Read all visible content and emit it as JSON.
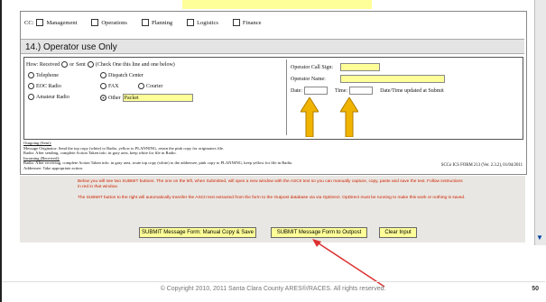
{
  "cc": {
    "label": "CC:",
    "options": [
      "Management",
      "Operations",
      "Planning",
      "Logistics",
      "Finance"
    ]
  },
  "section14": {
    "title": "14.) Operator use Only",
    "how_row": {
      "label": "How: Received",
      "or_label": "or",
      "sent_label": "Sent",
      "hint": "(Check One this line and one below)"
    },
    "channels": {
      "telephone": "Telephone",
      "dispatch": "Dispatch Center",
      "eoc_radio": "EOC Radio",
      "fax": "FAX",
      "courier": "Courier",
      "amateur": "Amateur Radio",
      "other": "Other",
      "other_value": "Packet"
    },
    "right": {
      "call_sign_label": "Operator Call Sign:",
      "name_label": "Operator Name:",
      "date_label": "Date:",
      "time_label": "Time:",
      "updated_label": "Date/Time updated at Submit"
    }
  },
  "instructions": {
    "outgoing_title": "Outgoing (Sent):",
    "line1": "Message Originator: Send the top copy (white) to Radio, yellow to PLANNING, retain the pink copy for originators file.",
    "line2": "Radio: After sending, complete Action Taken info. in gray area, keep white for file in Radio.",
    "incoming_title": "Incoming (Received):",
    "line3": "Radio: After receiving, complete Action Taken info. in gray area, route top copy (white) to the addressee, pink copy to PLANNING, keep yellow for file in Radio.",
    "line4": "Addressee: Take appropriate action.",
    "form_id": "SCCo ICS FORM 213 (Ver. 2.3.2), 01/04/2011"
  },
  "panel": {
    "text1": "Below you will see two SUBMIT buttons. The one on the left, when Submitted, will open a new window with the ASCII text so you can manually capture, copy, paste and save the text. Follow instructions in red in that window.",
    "text2": "The SUBMIT button to the right will automatically transfer the ASCII text extracted from the form to the Outpost database via via OpDirect. OpDirect must be running to make this work or nothing is saved.",
    "btn_manual": "SUBMIT Message Form: Manual Copy & Save",
    "btn_outpost": "SUBMIT Message Form to Outpost",
    "btn_clear": "Clear Input"
  },
  "footer": {
    "copyright": "© Copyright 2010, 2011 Santa Clara County ARES®/RACES. All rights reserved.",
    "slide_number": "50"
  },
  "colors": {
    "highlight": "#ffff99",
    "arrow": "#f0b400",
    "pointer": "#dd3030",
    "red_text": "#cc2200"
  }
}
